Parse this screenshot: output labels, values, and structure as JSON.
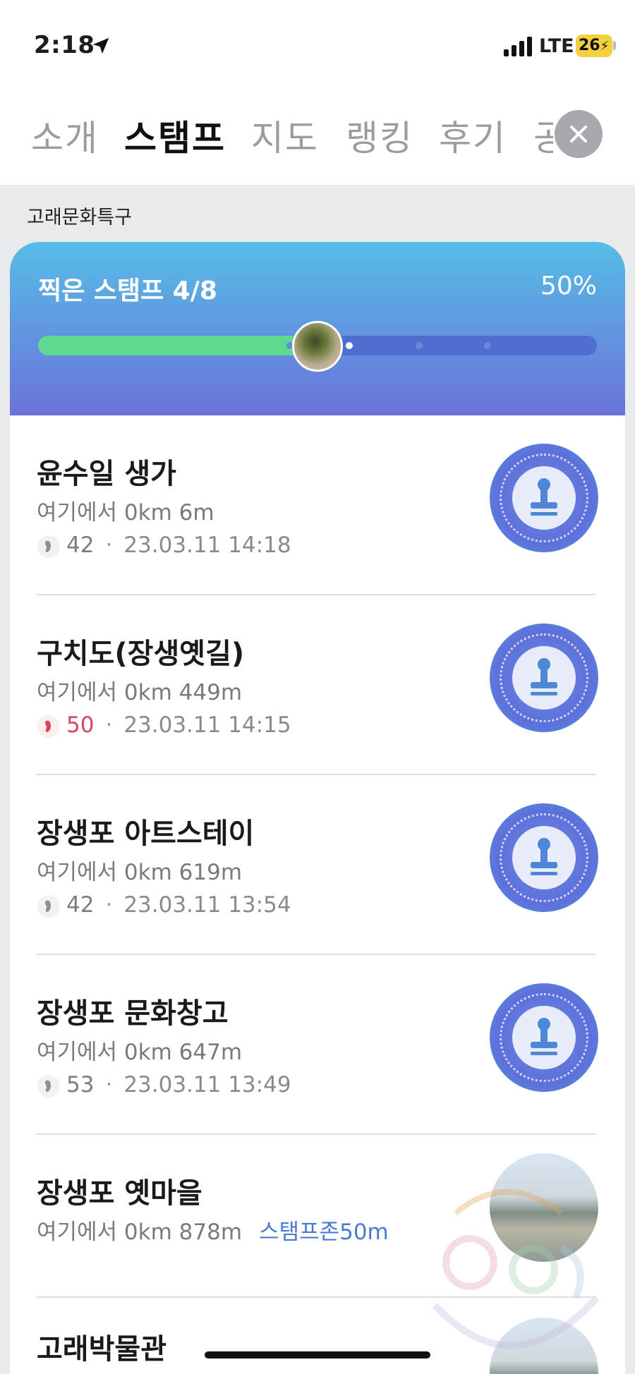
{
  "status_bar": {
    "time": "2:18",
    "network": "LTE",
    "battery": "26"
  },
  "tabs": [
    {
      "label": "소개"
    },
    {
      "label": "스탬프"
    },
    {
      "label": "지도"
    },
    {
      "label": "랭킹"
    },
    {
      "label": "후기"
    },
    {
      "label": "공"
    }
  ],
  "active_tab": "스탬프",
  "section": {
    "label": "고래문화특구"
  },
  "progress": {
    "title": "찍은 스탬프 4/8",
    "percent_label": "50%",
    "stamped": 4,
    "total": 8,
    "fraction": 0.5
  },
  "colors": {
    "progress_fill": "#5ed98f",
    "accent_blue": "#4a7bd0",
    "count_red": "#d8445c"
  },
  "items": [
    {
      "title": "윤수일 생가",
      "distance": "여기에서 0km 6m",
      "count": "42",
      "count_highlight": false,
      "datetime": "23.03.11 14:18",
      "icon": "stamp-icon"
    },
    {
      "title": "구치도(장생옛길)",
      "distance": "여기에서 0km 449m",
      "count": "50",
      "count_highlight": true,
      "datetime": "23.03.11 14:15",
      "icon": "stamp-icon"
    },
    {
      "title": "장생포 아트스테이",
      "distance": "여기에서 0km 619m",
      "count": "42",
      "count_highlight": false,
      "datetime": "23.03.11 13:54",
      "icon": "stamp-icon"
    },
    {
      "title": "장생포 문화창고",
      "distance": "여기에서 0km 647m",
      "count": "53",
      "count_highlight": false,
      "datetime": "23.03.11 13:49",
      "icon": "stamp-icon"
    },
    {
      "title": "장생포 옛마을",
      "distance": "여기에서 0km 878m",
      "zone": "스탬프존50m",
      "icon": "place-photo"
    },
    {
      "title": "고래박물관",
      "icon": "place-photo"
    }
  ],
  "meta_separator": "·"
}
